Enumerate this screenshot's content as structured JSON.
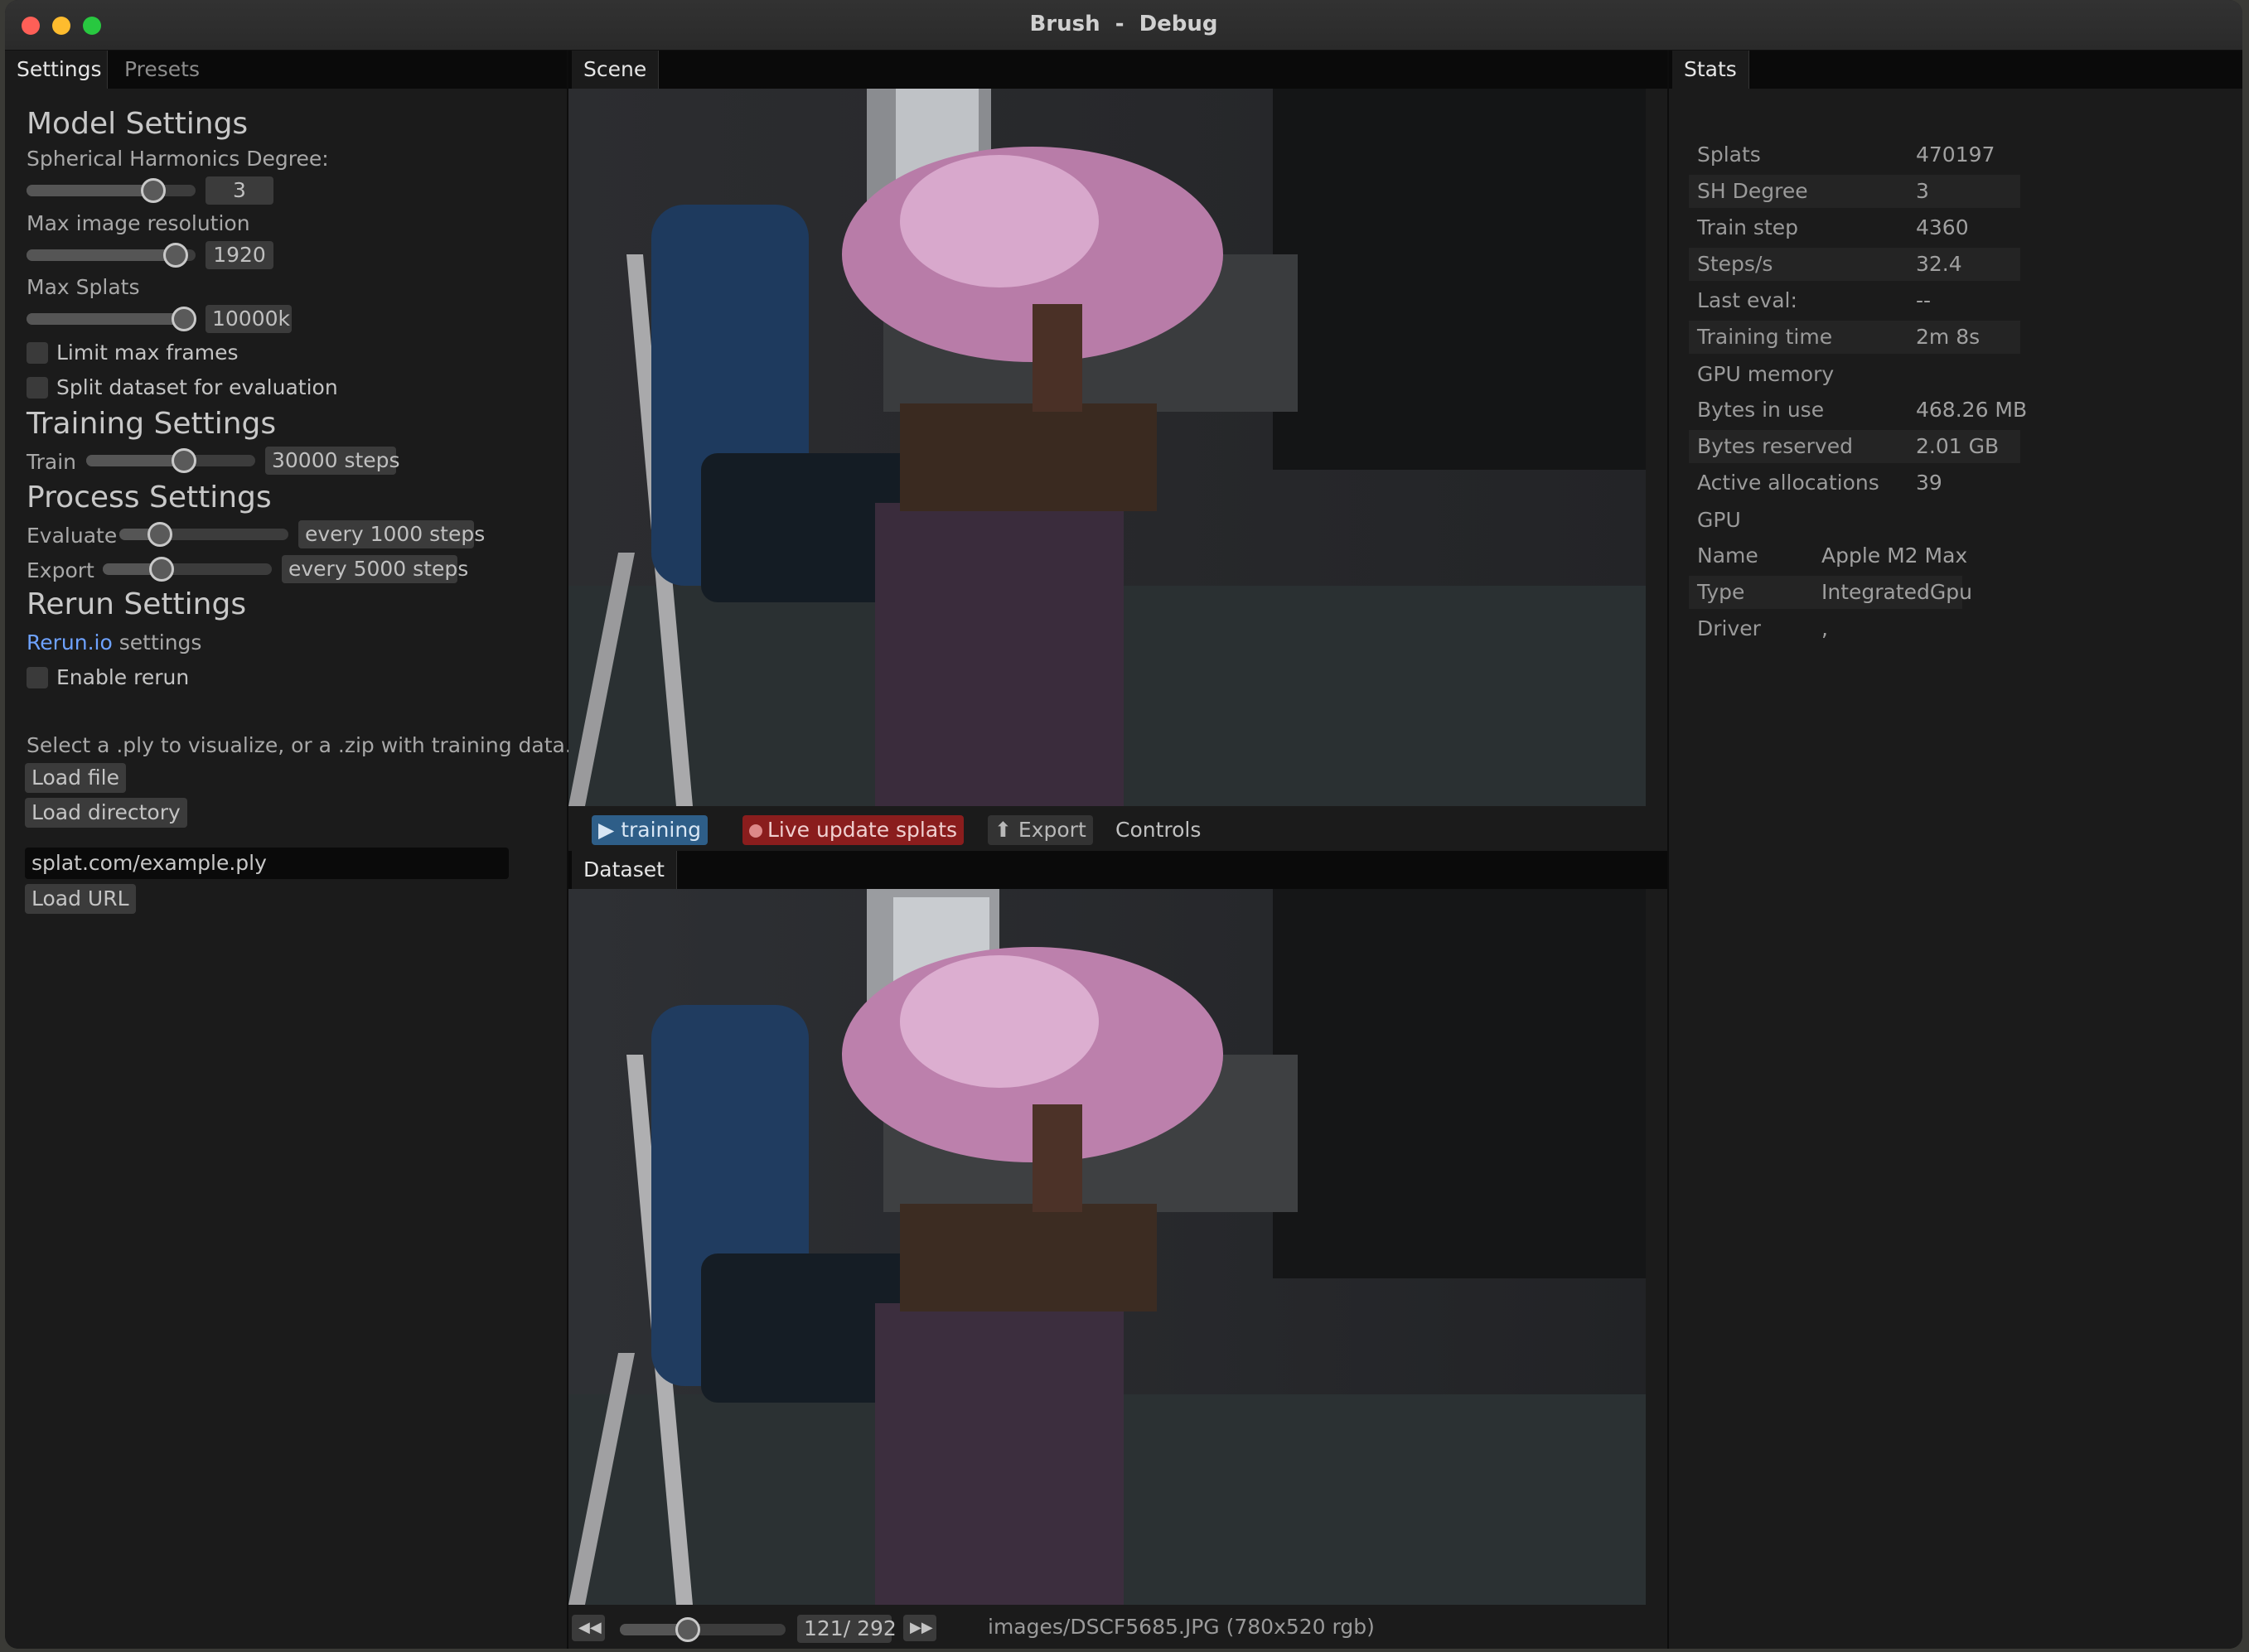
{
  "window": {
    "title": "Brush  -  Debug"
  },
  "left": {
    "tabs": [
      "Settings",
      "Presets"
    ],
    "model_settings": {
      "heading": "Model Settings",
      "sh_label": "Spherical Harmonics Degree:",
      "sh_value": "3",
      "sh_fraction": 0.75,
      "res_label": "Max image resolution",
      "res_value": "1920",
      "res_fraction": 0.88,
      "splats_label": "Max Splats",
      "splats_value": "10000k",
      "splats_fraction": 0.93,
      "limit_frames_label": "Limit max frames",
      "split_label": "Split dataset for evaluation"
    },
    "training_settings": {
      "heading": "Training Settings",
      "train_label": "Train",
      "train_value": "30000 steps",
      "train_fraction": 0.58
    },
    "process_settings": {
      "heading": "Process Settings",
      "evaluate_label": "Evaluate",
      "evaluate_value": "every 1000 steps",
      "evaluate_fraction": 0.24,
      "export_label": "Export",
      "export_value": "every 5000 steps",
      "export_fraction": 0.35
    },
    "rerun_settings": {
      "heading": "Rerun Settings",
      "link_text": "Rerun.io",
      "link_suffix": " settings",
      "enable_label": "Enable rerun"
    },
    "load": {
      "hint": "Select a .ply to visualize, or a .zip with training data.",
      "load_file": "Load file",
      "load_directory": "Load directory",
      "url_value": "splat.com/example.ply",
      "load_url": "Load URL"
    }
  },
  "center": {
    "scene_tab": "Scene",
    "dataset_tab": "Dataset",
    "toolbar": {
      "training": "training",
      "live_update": "Live update splats",
      "export": "Export",
      "controls": "Controls"
    },
    "dataset_nav": {
      "counter": "121/ 292",
      "frame_fraction": 0.41,
      "image_info": "images/DSCF5685.JPG (780x520 rgb)"
    }
  },
  "stats": {
    "tab": "Stats",
    "rows": [
      {
        "key": "Splats",
        "value": "470197"
      },
      {
        "key": "SH Degree",
        "value": "3"
      },
      {
        "key": "Train step",
        "value": "4360"
      },
      {
        "key": "Steps/s",
        "value": "32.4"
      },
      {
        "key": "Last eval:",
        "value": "--"
      },
      {
        "key": "Training time",
        "value": "2m 8s"
      }
    ],
    "gpu_memory_heading": "GPU memory",
    "memory_rows": [
      {
        "key": "Bytes in use",
        "value": "468.26 MB"
      },
      {
        "key": "Bytes reserved",
        "value": "2.01 GB"
      },
      {
        "key": "Active allocations",
        "value": "39"
      }
    ],
    "gpu_heading": "GPU",
    "gpu_rows": [
      {
        "key": "Name",
        "value": "Apple M2 Max"
      },
      {
        "key": "Type",
        "value": "IntegratedGpu"
      },
      {
        "key": "Driver",
        "value": ","
      }
    ]
  },
  "colors": {
    "accent_blue": "#2e5e88",
    "live_red": "#8a1d1d",
    "link": "#6ea2ff"
  }
}
